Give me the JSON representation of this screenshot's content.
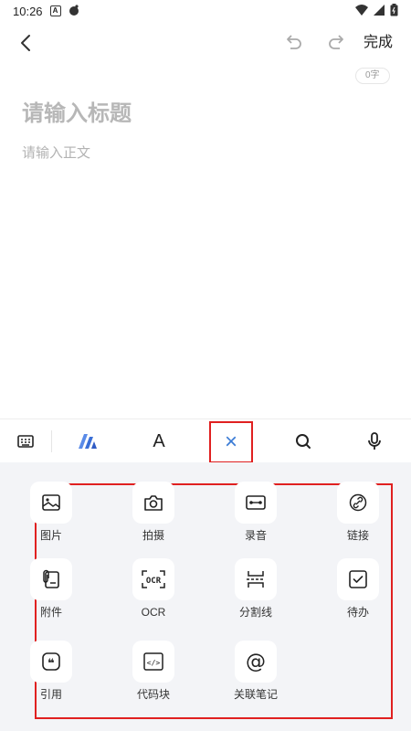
{
  "status_bar": {
    "time": "10:26",
    "notif_icon_letter": "A"
  },
  "top_bar": {
    "done_label": "完成"
  },
  "editor": {
    "word_count": "0字",
    "title_placeholder": "请输入标题",
    "body_placeholder": "请输入正文"
  },
  "toolbar": {
    "items": [
      "keyboard-icon",
      "ai-logo-icon",
      "text-format-icon",
      "close-icon",
      "search-icon",
      "microphone-icon"
    ],
    "text_format_glyph": "A",
    "close_glyph": "×",
    "accent_color": "#3a7bd5",
    "highlight_color": "#e02020"
  },
  "insert_panel": {
    "items": [
      {
        "label": "图片",
        "icon": "image-icon"
      },
      {
        "label": "拍摄",
        "icon": "camera-icon"
      },
      {
        "label": "录音",
        "icon": "audio-record-icon"
      },
      {
        "label": "链接",
        "icon": "link-icon"
      },
      {
        "label": "附件",
        "icon": "attachment-icon"
      },
      {
        "label": "OCR",
        "icon": "ocr-icon",
        "glyph": "OCR"
      },
      {
        "label": "分割线",
        "icon": "divider-line-icon"
      },
      {
        "label": "待办",
        "icon": "todo-checkbox-icon"
      },
      {
        "label": "引用",
        "icon": "quote-icon",
        "glyph": "❝"
      },
      {
        "label": "代码块",
        "icon": "code-block-icon",
        "glyph": "</>"
      },
      {
        "label": "关联笔记",
        "icon": "related-note-icon",
        "glyph": "@"
      }
    ]
  }
}
